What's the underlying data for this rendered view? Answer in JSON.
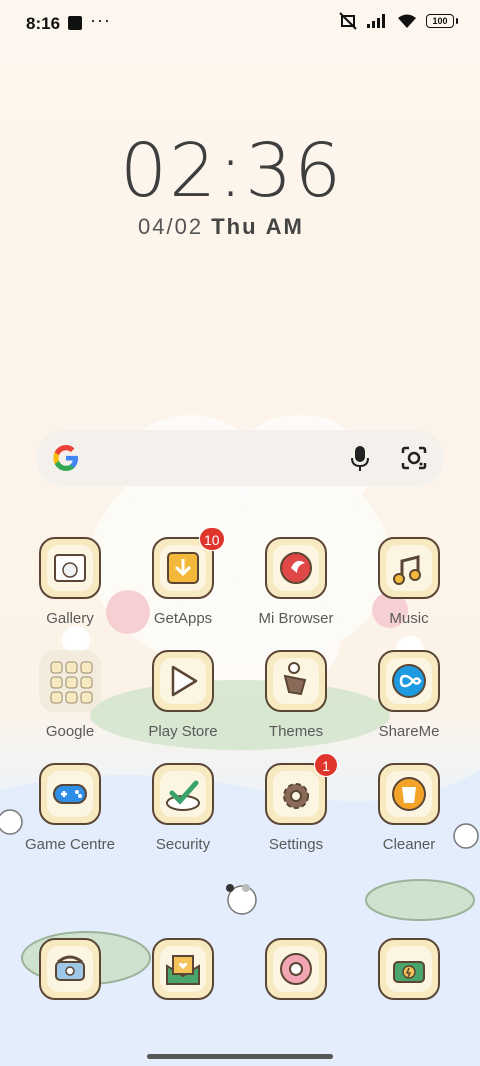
{
  "status_bar": {
    "time": "8:16",
    "more": "···",
    "battery": "100"
  },
  "lockclock": {
    "time": "02:36",
    "date": "04/02",
    "weekday": "Thu",
    "ampm": "AM"
  },
  "search": {
    "google_icon": "google-g-icon",
    "mic_icon": "microphone-icon",
    "lens_icon": "camera-lens-icon"
  },
  "apps": [
    {
      "label": "Gallery",
      "icon": "gallery-icon"
    },
    {
      "label": "GetApps",
      "icon": "download-icon",
      "badge": "10"
    },
    {
      "label": "Mi Browser",
      "icon": "browser-icon"
    },
    {
      "label": "Music",
      "icon": "music-note-icon"
    },
    {
      "label": "Google",
      "icon": "folder-icon"
    },
    {
      "label": "Play Store",
      "icon": "play-store-icon"
    },
    {
      "label": "Themes",
      "icon": "paint-brush-icon"
    },
    {
      "label": "ShareMe",
      "icon": "infinity-icon"
    },
    {
      "label": "Game Centre",
      "icon": "gamepad-icon"
    },
    {
      "label": "Security",
      "icon": "shield-check-icon"
    },
    {
      "label": "Settings",
      "icon": "gear-icon",
      "badge": "1"
    },
    {
      "label": "Cleaner",
      "icon": "trash-icon"
    }
  ],
  "dock": [
    {
      "icon": "phone-icon"
    },
    {
      "icon": "message-icon"
    },
    {
      "icon": "chrome-icon"
    },
    {
      "icon": "camera-icon"
    }
  ],
  "colors": {
    "badge": "#e0352d",
    "icon_border": "#5b4636",
    "icon_bg": "#f7e9c0"
  }
}
